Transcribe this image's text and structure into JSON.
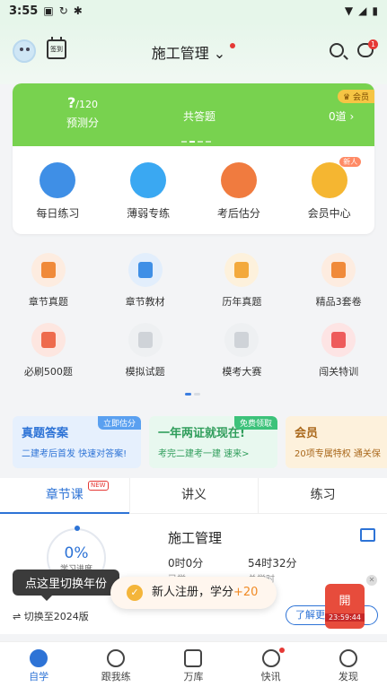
{
  "status_bar": {
    "time": "3:55",
    "app_icons": [
      "app-icon",
      "sync-icon",
      "bug-icon"
    ],
    "right_icons": [
      "wifi-icon",
      "signal-icon",
      "battery-icon"
    ]
  },
  "header": {
    "title": "施工管理",
    "signin_label": "签到",
    "message_badge": "1"
  },
  "summary": {
    "vip_tag": "会员",
    "predict_value": "?",
    "predict_total": "/120",
    "predict_label": "预测分",
    "total_label": "共答题",
    "total_value": "0道"
  },
  "quick_actions": [
    {
      "label": "每日练习",
      "icon": "clock-icon",
      "color": "#3f8fe6"
    },
    {
      "label": "薄弱专练",
      "icon": "chat-icon",
      "color": "#3aa8f2"
    },
    {
      "label": "考后估分",
      "icon": "estimate-icon",
      "color": "#f07b3f"
    },
    {
      "label": "会员中心",
      "icon": "crown-icon",
      "color": "#f5b631",
      "tag": "新人"
    }
  ],
  "grid": [
    {
      "label": "章节真题",
      "icon": "gear-book-icon",
      "color": "#f08a3a",
      "bg": "#fdece0"
    },
    {
      "label": "章节教材",
      "icon": "shield-book-icon",
      "color": "#3f8fe6",
      "bg": "#e2eefc"
    },
    {
      "label": "历年真题",
      "icon": "folder-icon",
      "color": "#f3a93c",
      "bg": "#fdf1dc"
    },
    {
      "label": "精品3套卷",
      "icon": "document-icon",
      "color": "#f08a3a",
      "bg": "#fdece0"
    },
    {
      "label": "必刷500题",
      "icon": "book-500-icon",
      "color": "#ee6b4d",
      "bg": "#fde6e0"
    },
    {
      "label": "模拟试题",
      "icon": "blurred-icon",
      "color": "#cfd3d8",
      "bg": "#eef0f2"
    },
    {
      "label": "模考大赛",
      "icon": "blurred-icon",
      "color": "#cfd3d8",
      "bg": "#eef0f2"
    },
    {
      "label": "闯关特训",
      "icon": "target-icon",
      "color": "#ee5b5b",
      "bg": "#fde4e4"
    }
  ],
  "banners": [
    {
      "title": "真题答案",
      "subtitle": "二建考后首发  快速对答案!",
      "tag": "立即估分",
      "bg": "#e6f0fd",
      "color": "#2d73d6",
      "tag_color": "#5aa0f0"
    },
    {
      "title": "一年两证就现在!",
      "subtitle": "考完二建考一建  速来>",
      "tag": "免费领取",
      "bg": "#e8f8ef",
      "color": "#2f9d5b",
      "tag_color": "#3cc27a"
    },
    {
      "title": "会员",
      "subtitle": "20项专属特权  通关保",
      "tag": "",
      "bg": "#fdf1dc",
      "color": "#a9671a",
      "tag_color": "#f5b631"
    }
  ],
  "tabs": [
    {
      "label": "章节课",
      "new": "NEW"
    },
    {
      "label": "讲义"
    },
    {
      "label": "练习"
    }
  ],
  "course": {
    "percent": "0%",
    "progress_label": "学习进度",
    "title": "施工管理",
    "studied_time": "0时0分",
    "studied_label": "已学",
    "total_time": "54时32分",
    "total_label": "总学时",
    "switch_label": "⇌ 切换至2024版",
    "learn_more": "了解更多"
  },
  "tooltip": "点这里切换年份",
  "toast": {
    "text": "新人注册，学分",
    "points": "+20"
  },
  "float_box": {
    "label": "開",
    "countdown": "23:59:44"
  },
  "nav": [
    {
      "label": "自学",
      "icon": "study-icon",
      "active": true
    },
    {
      "label": "跟我练",
      "icon": "check-circle-icon"
    },
    {
      "label": "万库",
      "icon": "library-icon"
    },
    {
      "label": "快讯",
      "icon": "flash-icon",
      "dot": true
    },
    {
      "label": "发现",
      "icon": "compass-icon"
    }
  ]
}
